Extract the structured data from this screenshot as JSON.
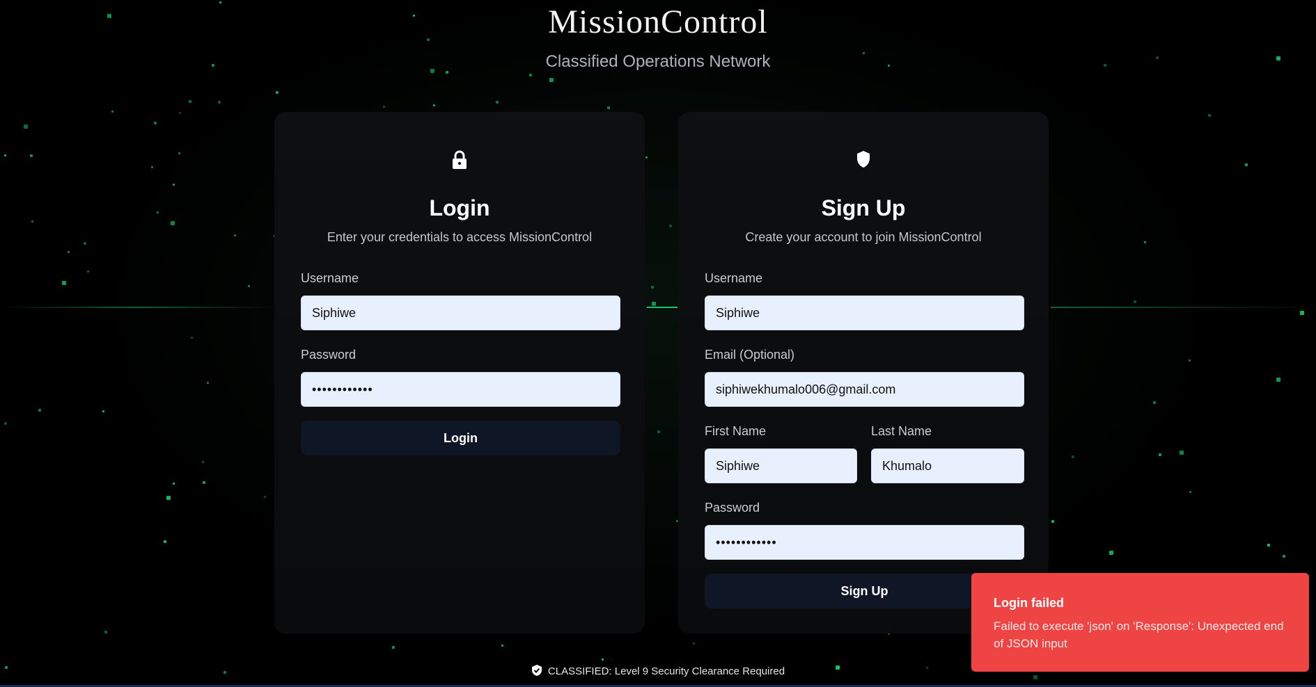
{
  "brand": {
    "title": "MissionControl",
    "tagline": "Classified Operations Network"
  },
  "login": {
    "icon": "lock-icon",
    "title": "Login",
    "subtitle": "Enter your credentials to access MissionControl",
    "username_label": "Username",
    "username_value": "Siphiwe",
    "password_label": "Password",
    "password_value": "••••••••••••",
    "button_label": "Login"
  },
  "signup": {
    "icon": "shield-icon",
    "title": "Sign Up",
    "subtitle": "Create your account to join MissionControl",
    "username_label": "Username",
    "username_value": "Siphiwe",
    "email_label": "Email (Optional)",
    "email_value": "siphiwekhumalo006@gmail.com",
    "first_name_label": "First Name",
    "first_name_value": "Siphiwe",
    "last_name_label": "Last Name",
    "last_name_value": "Khumalo",
    "password_label": "Password",
    "password_value": "••••••••••••",
    "button_label": "Sign Up"
  },
  "footer": {
    "icon": "shield-check-icon",
    "text": "CLASSIFIED: Level 9 Security Clearance Required"
  },
  "toast": {
    "title": "Login failed",
    "message": "Failed to execute 'json' on 'Response': Unexpected end of JSON input"
  },
  "colors": {
    "accent_green": "#15c46a",
    "button_bg": "#0f1727",
    "input_bg": "#e8effd",
    "toast_bg": "#ee4444"
  }
}
